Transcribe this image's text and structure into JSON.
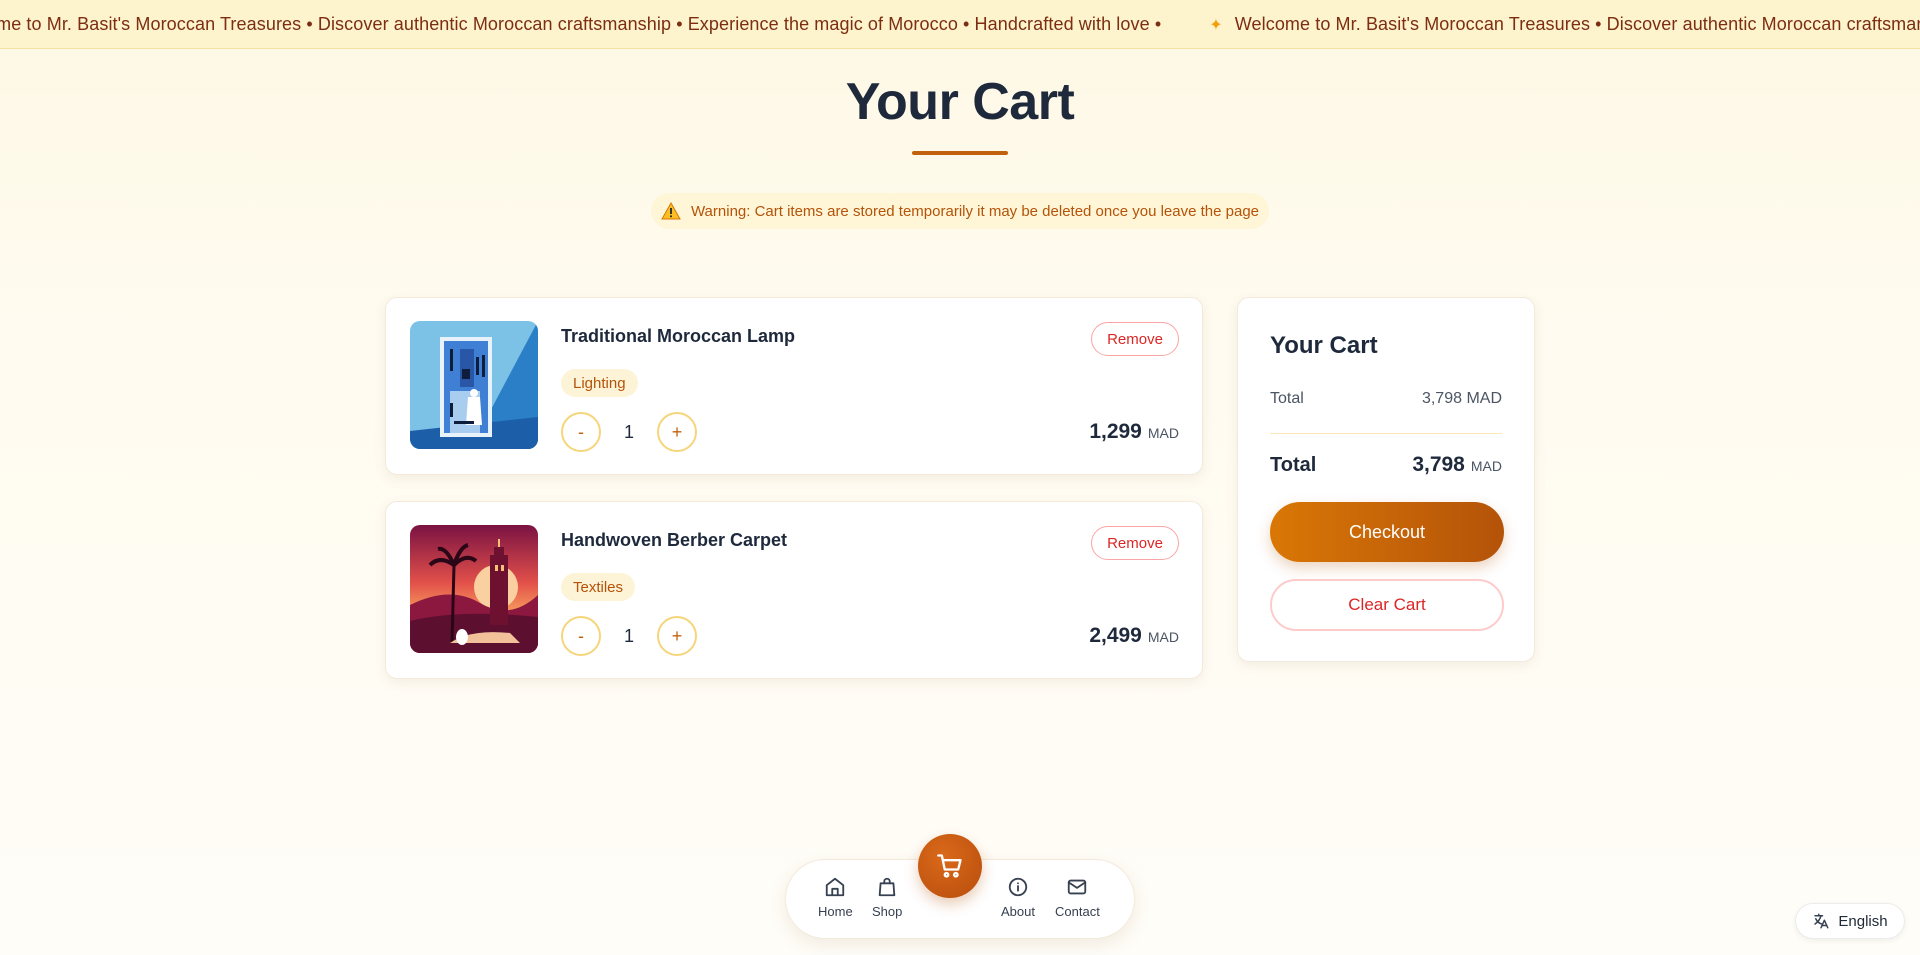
{
  "marquee": {
    "segments": [
      "ome to Mr. Basit's Moroccan Treasures • Discover authentic Moroccan craftsmanship • Experience the magic of Morocco • Handcrafted with love •",
      "Welcome to Mr. Basit's Moroccan Treasures • Discover authentic Moroccan craftsmanship • Experience the magic of Morocco • Handcrafted with love •"
    ],
    "star": "✦"
  },
  "page": {
    "title": "Your Cart",
    "warning": "Warning: Cart items are stored temporarily it may be deleted once you leave the page"
  },
  "cart": {
    "items": [
      {
        "name": "Traditional Moroccan Lamp",
        "category": "Lighting",
        "quantity": "1",
        "price": "1,299",
        "currency": "MAD",
        "remove_label": "Remove",
        "decrement_label": "-",
        "increment_label": "+",
        "image": "blue-city-illustration"
      },
      {
        "name": "Handwoven Berber Carpet",
        "category": "Textiles",
        "quantity": "1",
        "price": "2,499",
        "currency": "MAD",
        "remove_label": "Remove",
        "decrement_label": "-",
        "increment_label": "+",
        "image": "sunset-mosque-illustration"
      }
    ]
  },
  "summary": {
    "title": "Your Cart",
    "subtotal_label": "Total",
    "subtotal_value": "3,798 MAD",
    "total_label": "Total",
    "total_value": "3,798",
    "total_currency": "MAD",
    "checkout_label": "Checkout",
    "clear_label": "Clear Cart"
  },
  "nav": {
    "home": "Home",
    "shop": "Shop",
    "about": "About",
    "contact": "Contact",
    "cart_icon": "shopping-cart-icon"
  },
  "language": {
    "label": "English",
    "icon": "translate-icon"
  },
  "colors": {
    "accent": "#c2620e",
    "danger": "#dc2626",
    "marquee_bg": "#fdf3cc",
    "marquee_text": "#7c2d12"
  }
}
